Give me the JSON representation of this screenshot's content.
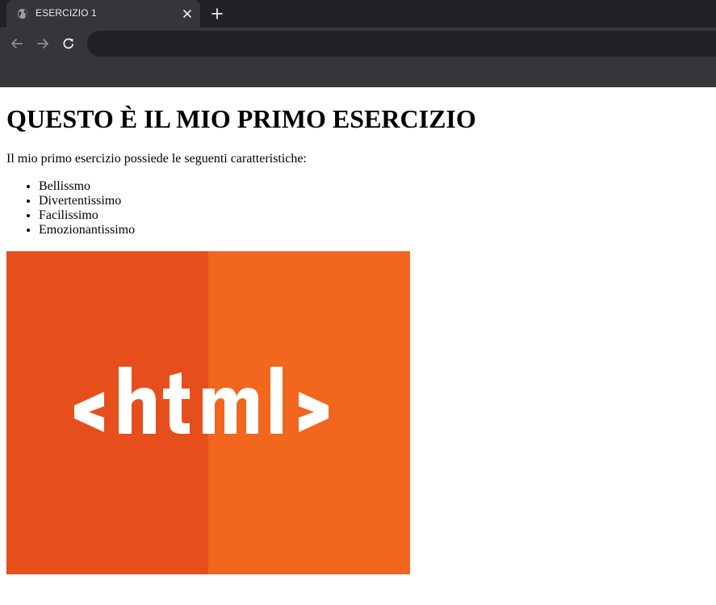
{
  "browser": {
    "tab_title": "ESERCIZIO 1",
    "address": ""
  },
  "page": {
    "heading": "QUESTO È IL MIO PRIMO ESERCIZIO",
    "intro": "Il mio primo esercizio possiede le seguenti caratteristiche:",
    "features": [
      "Bellissmo",
      "Divertentissimo",
      "Facilissimo",
      "Emozionantissimo"
    ],
    "image": {
      "logo_text": "<html>",
      "left_color": "#e64f1b",
      "right_color": "#f2661e",
      "text_color": "#ffffff"
    }
  }
}
